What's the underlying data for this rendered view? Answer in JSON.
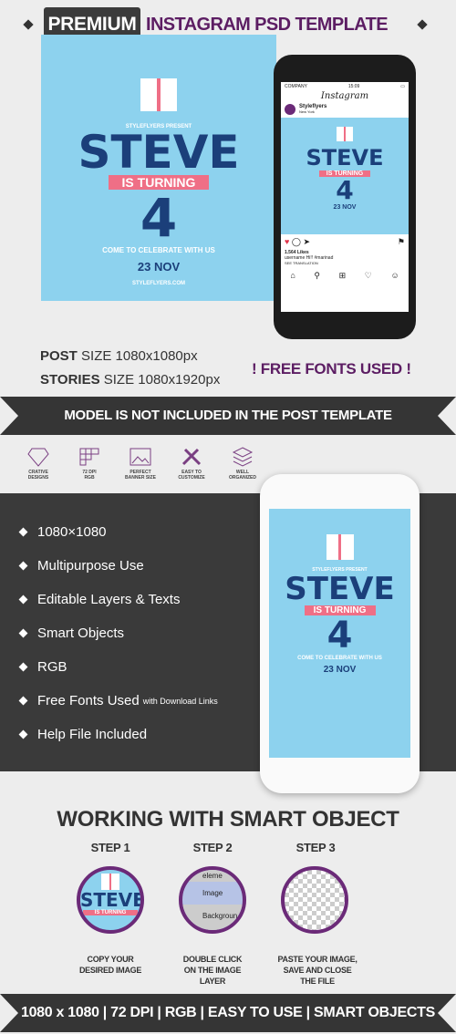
{
  "header": {
    "badge": "PREMIUM",
    "title": "INSTAGRAM  PSD TEMPLATE"
  },
  "poster": {
    "presents": "STYLEFLYERS PRESENT",
    "name": "STEVE",
    "turning": "IS TURNING",
    "age": "4",
    "celebrate": "COME TO CELEBRATE WITH US",
    "date": "23 NOV",
    "site": "STYLEFLYERS.COM"
  },
  "phone": {
    "carrier": "COMPANY",
    "time": "15:09",
    "app": "Instagram",
    "account": "Styleflyers",
    "location": "New York",
    "likes": "1.564 Likes",
    "caption": "username Hi!! #marinad",
    "translate": "SEE TRANSLATION"
  },
  "sizes": {
    "post_label": "POST",
    "post_rest": "SIZE 1080x1080px",
    "stories_label": "STORIES",
    "stories_rest": "SIZE 1080x1920px",
    "free_fonts": "! FREE FONTS USED !"
  },
  "ribbon1": "MODEL IS NOT INCLUDED  IN THE POST TEMPLATE",
  "icons": [
    {
      "icon": "diamond-icon",
      "l1": "CRATIVE",
      "l2": "DESIGNS"
    },
    {
      "icon": "grid-icon",
      "l1": "72 DPI",
      "l2": "RGB"
    },
    {
      "icon": "image-icon",
      "l1": "PERFECT",
      "l2": "BANNER SIZE"
    },
    {
      "icon": "pencil-ruler-icon",
      "l1": "EASY TO",
      "l2": "CUSTOMIZE"
    },
    {
      "icon": "layers-icon",
      "l1": "WELL",
      "l2": "ORGANIZED"
    }
  ],
  "features": [
    "1080×1080",
    "Multipurpose Use",
    "Editable Layers & Texts",
    "Smart Objects",
    "RGB",
    "Free Fonts Used",
    "Help File Included"
  ],
  "features_note": "with Download Links",
  "smart": {
    "title": "WORKING WITH SMART OBJECT",
    "steps": [
      {
        "label": "STEP 1",
        "cap1": "COPY YOUR",
        "cap2": "DESIRED IMAGE",
        "cap3": ""
      },
      {
        "label": "STEP 2",
        "cap1": "DOUBLE CLICK",
        "cap2": "ON THE IMAGE",
        "cap3": "LAYER"
      },
      {
        "label": "STEP 3",
        "cap1": "PASTE YOUR IMAGE,",
        "cap2": "SAVE AND CLOSE",
        "cap3": "THE FILE"
      }
    ],
    "layers": [
      "eleme",
      "Image",
      "Backgroun"
    ]
  },
  "footer": "1080 x 1080  |  72 DPI  |  RGB  |  EASY TO USE  |  SMART OBJECTS",
  "colors": {
    "purple": "#5c1d63",
    "dark": "#353535",
    "sky": "#8dd2ee",
    "navy": "#1b3f7a",
    "pink": "#ef6f86"
  }
}
